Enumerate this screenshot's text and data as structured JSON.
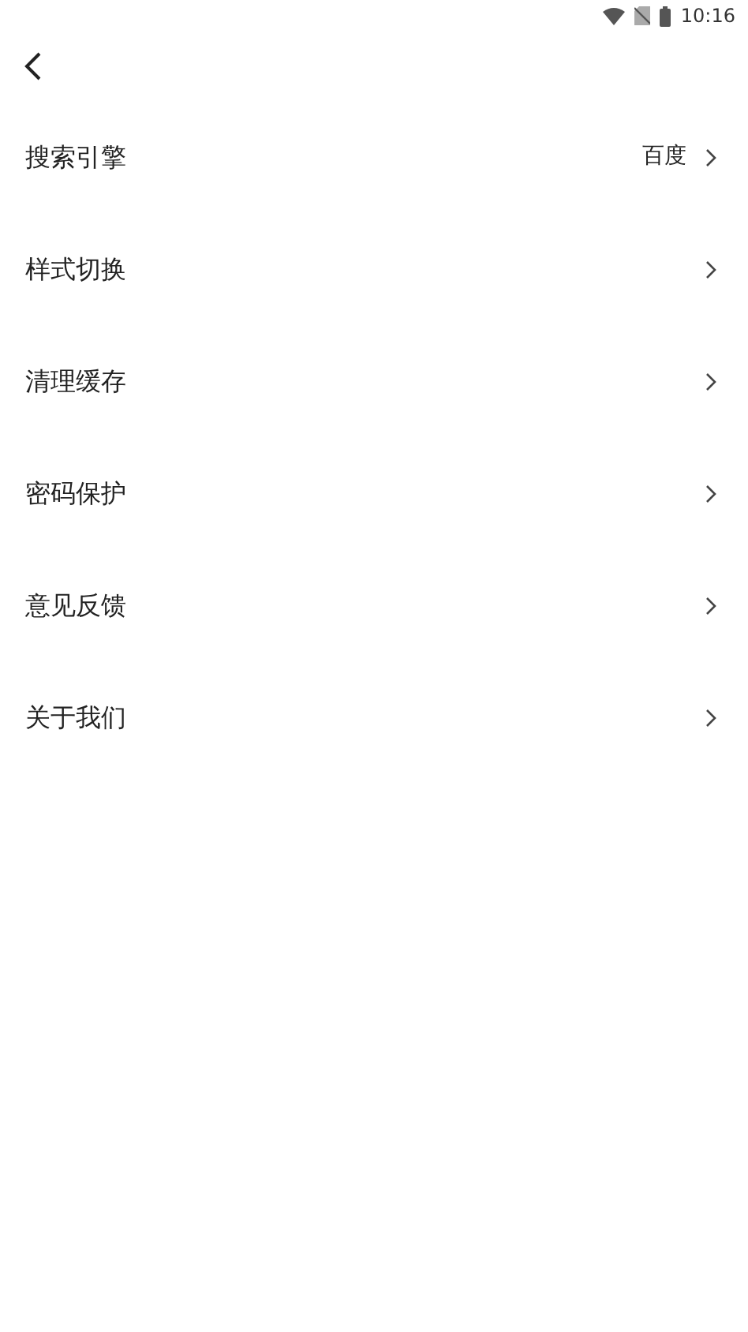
{
  "status_bar": {
    "time": "10:16"
  },
  "items": [
    {
      "label": "搜索引擎",
      "value": "百度"
    },
    {
      "label": "样式切换"
    },
    {
      "label": "清理缓存"
    },
    {
      "label": "密码保护"
    },
    {
      "label": "意见反馈"
    },
    {
      "label": "关于我们"
    }
  ]
}
